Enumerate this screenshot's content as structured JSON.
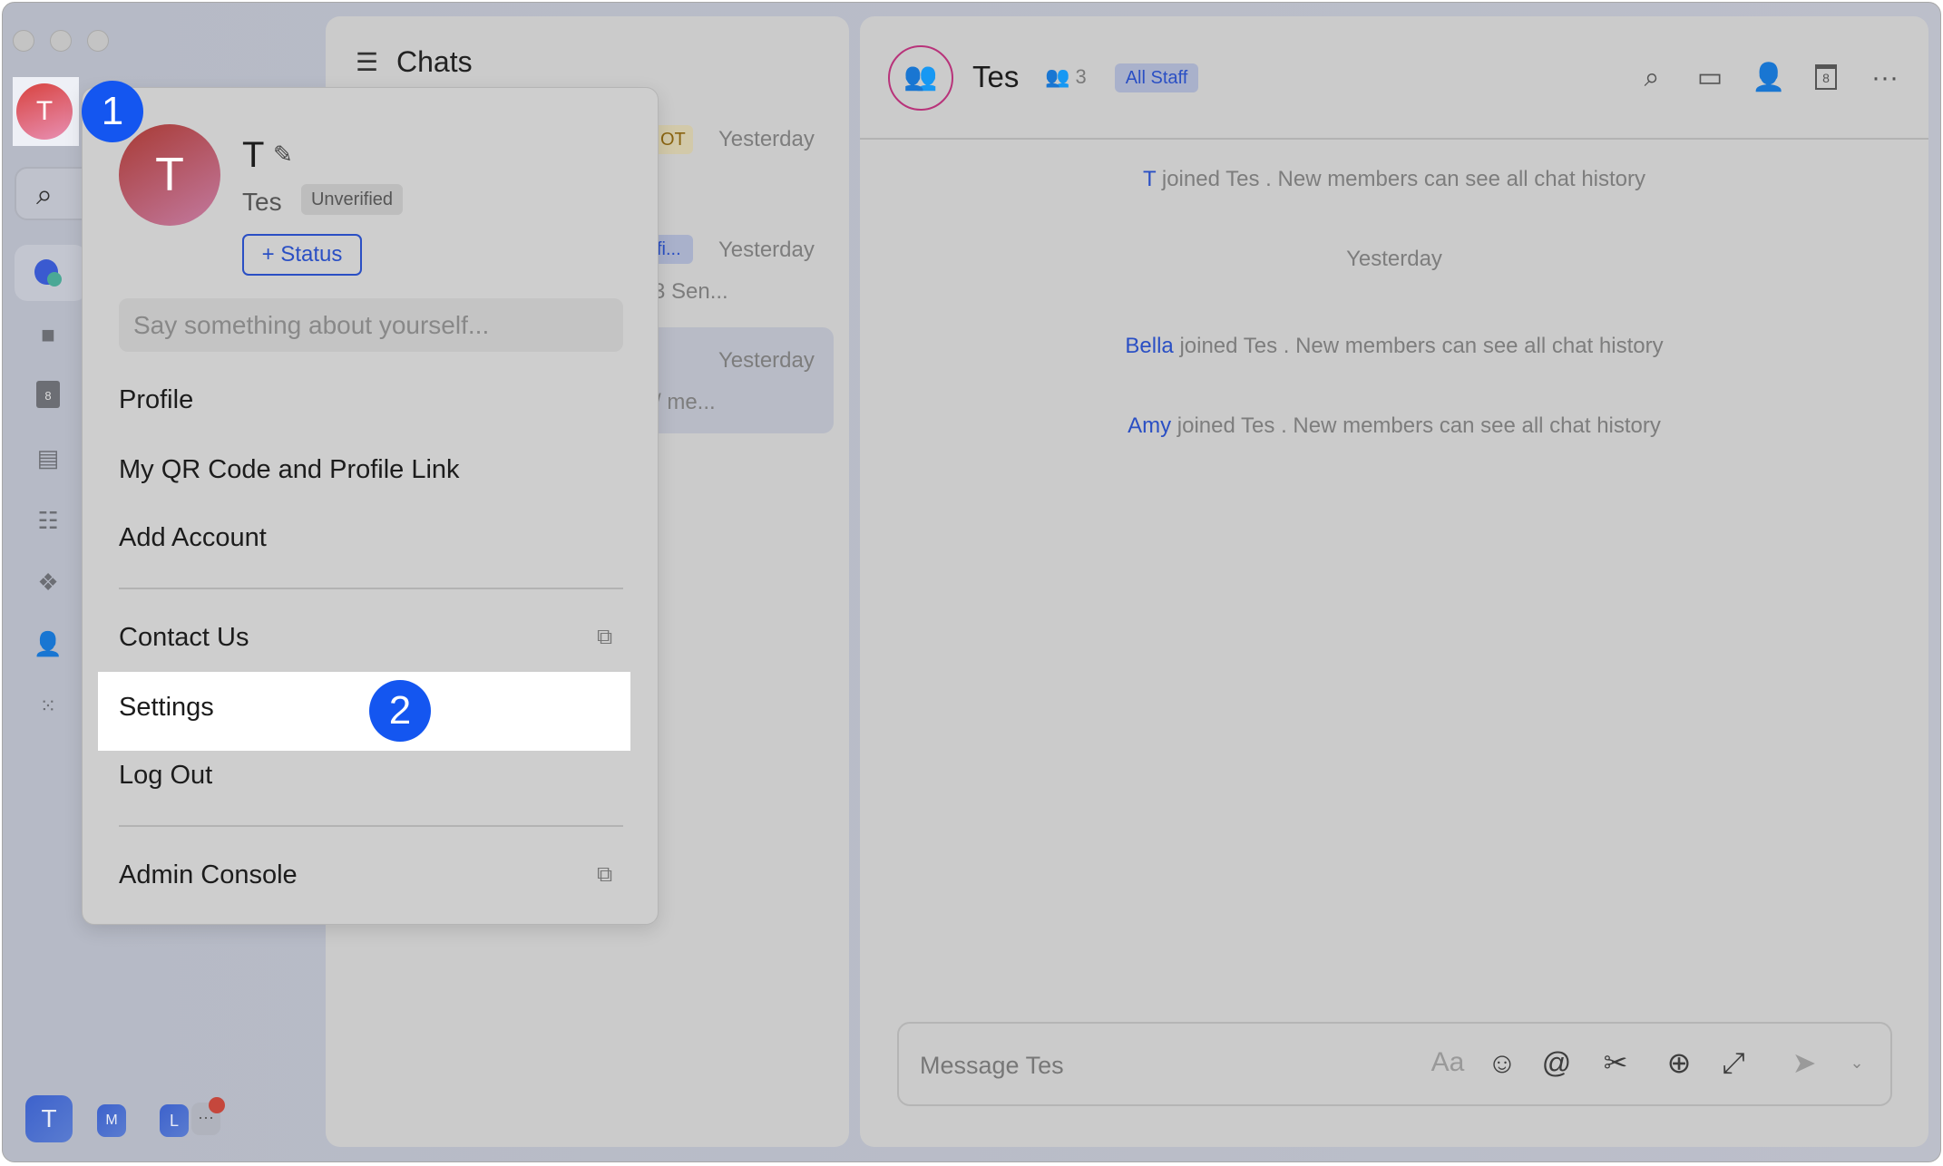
{
  "sidebar": {
    "avatar_initial": "T",
    "bottom_workspaces": [
      {
        "initial": "T"
      },
      {
        "initial": "M"
      },
      {
        "initial": "L"
      }
    ],
    "more_label": "···",
    "icons": [
      "messenger-icon",
      "video-meeting-icon",
      "calendar-icon",
      "docs-icon",
      "tasks-icon",
      "workplace-icon",
      "contacts-icon",
      "apps-grid-icon"
    ],
    "calendar_day": "8"
  },
  "chat_list": {
    "title": "Chats",
    "items": [
      {
        "tag": "OT",
        "time": "Yesterday",
        "preview": ""
      },
      {
        "tag": "fi...",
        "time": "Yesterday",
        "preview": "3 Sen..."
      },
      {
        "tag": "",
        "time": "Yesterday",
        "preview": "/ me..."
      }
    ]
  },
  "popup": {
    "avatar_initial": "T",
    "name": "T",
    "org": "Tes",
    "verify_badge": "Unverified",
    "status_button": "+ Status",
    "bio_placeholder": "Say something about yourself...",
    "menu": {
      "profile": "Profile",
      "qr": "My QR Code and Profile Link",
      "add_account": "Add Account",
      "contact": "Contact Us",
      "settings": "Settings",
      "logout": "Log Out",
      "admin": "Admin Console"
    }
  },
  "steps": {
    "one": "1",
    "two": "2"
  },
  "chat": {
    "title": "Tes",
    "member_count": "3",
    "tag": "All Staff",
    "calendar_day": "8",
    "messages": [
      {
        "name": "T",
        "text": " joined Tes . New members can see all chat history"
      },
      {
        "divider": "Yesterday"
      },
      {
        "name": "Bella",
        "text": " joined Tes . New members can see all chat history"
      },
      {
        "name": "Amy",
        "text": " joined Tes . New members can see all chat history"
      }
    ],
    "composer_placeholder": "Message Tes"
  },
  "colors": {
    "accent": "#1456f0",
    "link": "#2a4fc4",
    "group_avatar": "#b8337a"
  }
}
